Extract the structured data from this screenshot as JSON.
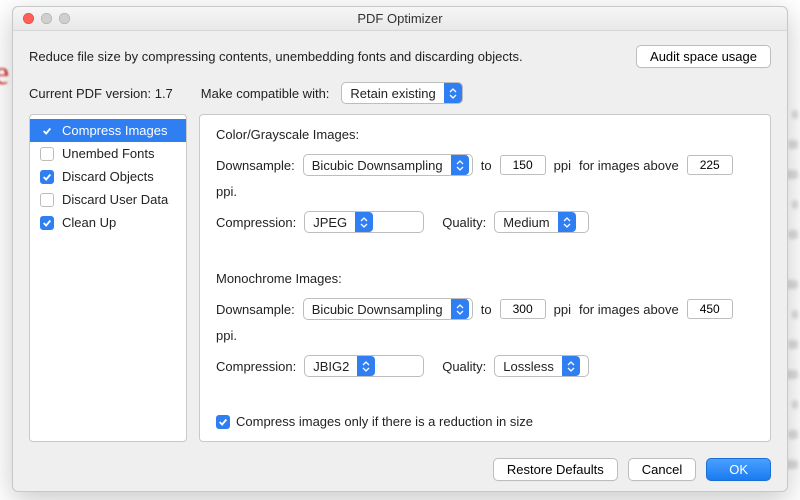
{
  "window": {
    "title": "PDF Optimizer"
  },
  "description": "Reduce file size by compressing contents, unembedding fonts and discarding objects.",
  "audit_button": "Audit space usage",
  "pdf_version": {
    "label": "Current PDF version:",
    "value": "1.7"
  },
  "compat": {
    "label": "Make compatible with:",
    "value": "Retain existing"
  },
  "sidebar": {
    "items": [
      {
        "label": "Compress Images",
        "checked": true,
        "active": true
      },
      {
        "label": "Unembed Fonts",
        "checked": false,
        "active": false
      },
      {
        "label": "Discard Objects",
        "checked": true,
        "active": false
      },
      {
        "label": "Discard User Data",
        "checked": false,
        "active": false
      },
      {
        "label": "Clean Up",
        "checked": true,
        "active": false
      }
    ]
  },
  "panel": {
    "color_heading": "Color/Grayscale Images:",
    "mono_heading": "Monochrome Images:",
    "labels": {
      "downsample": "Downsample:",
      "to": "to",
      "ppi": "ppi",
      "for_above": "for images above",
      "ppi_dot": "ppi.",
      "compression": "Compression:",
      "quality": "Quality:"
    },
    "color": {
      "downsample_method": "Bicubic Downsampling",
      "target_ppi": "150",
      "above_ppi": "225",
      "compression": "JPEG",
      "quality": "Medium"
    },
    "mono": {
      "downsample_method": "Bicubic Downsampling",
      "target_ppi": "300",
      "above_ppi": "450",
      "compression": "JBIG2",
      "quality": "Lossless"
    },
    "reduce_only": {
      "label": "Compress images only if there is a reduction in size",
      "checked": true
    }
  },
  "footer": {
    "restore": "Restore Defaults",
    "cancel": "Cancel",
    "ok": "OK"
  }
}
